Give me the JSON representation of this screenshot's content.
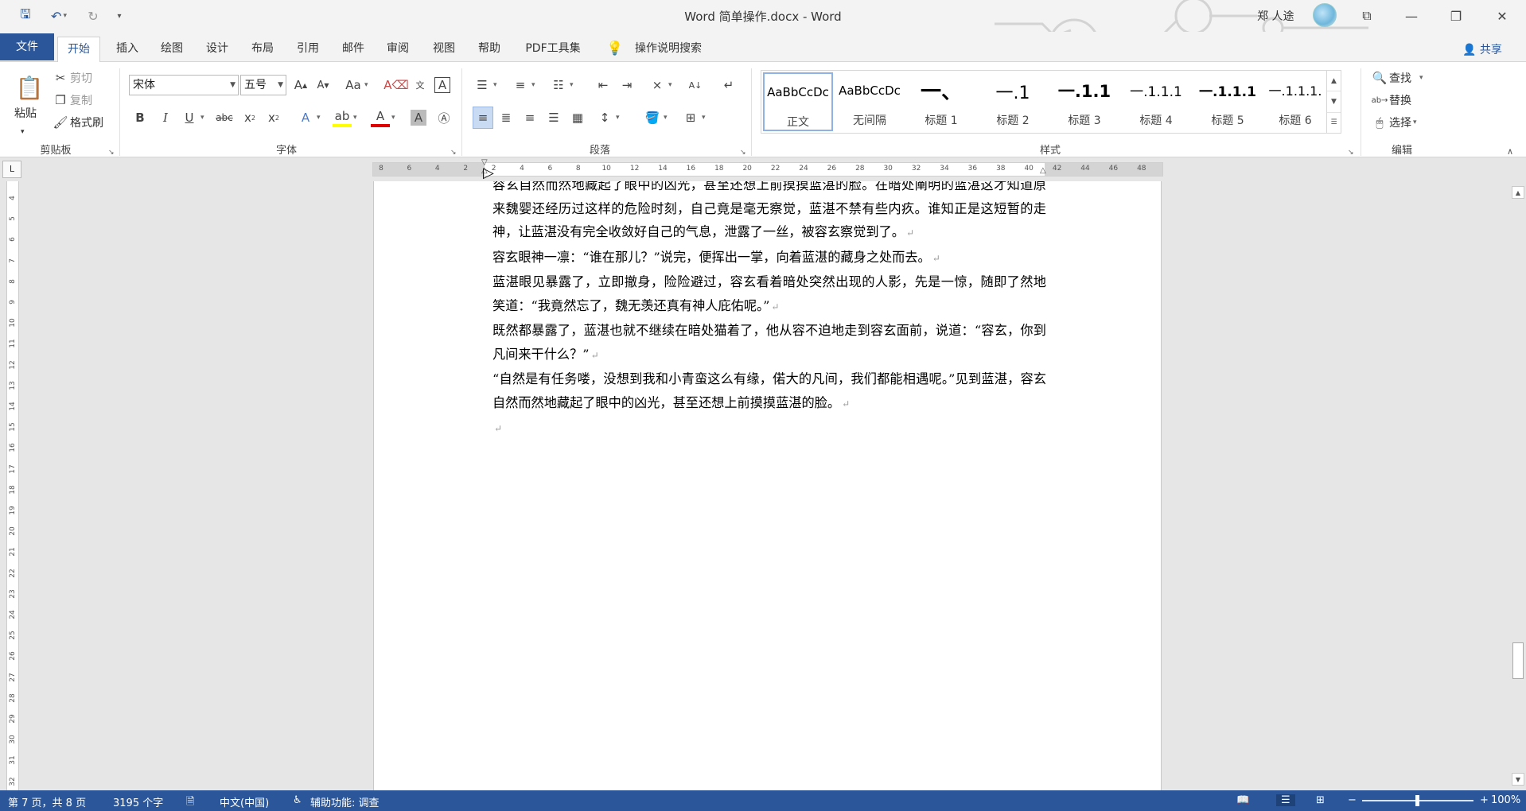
{
  "window": {
    "title": "Word 简单操作.docx  -  Word",
    "user_name": "郑 人途"
  },
  "tabs": [
    {
      "id": "tab-file",
      "label": "文件"
    },
    {
      "id": "tab-home",
      "label": "开始"
    },
    {
      "id": "tab-insert",
      "label": "插入"
    },
    {
      "id": "tab-draw",
      "label": "绘图"
    },
    {
      "id": "tab-design",
      "label": "设计"
    },
    {
      "id": "tab-layout",
      "label": "布局"
    },
    {
      "id": "tab-references",
      "label": "引用"
    },
    {
      "id": "tab-mailings",
      "label": "邮件"
    },
    {
      "id": "tab-review",
      "label": "审阅"
    },
    {
      "id": "tab-view",
      "label": "视图"
    },
    {
      "id": "tab-help",
      "label": "帮助"
    },
    {
      "id": "tab-pdf",
      "label": "PDF工具集"
    }
  ],
  "tell_me": "操作说明搜索",
  "share": "共享",
  "clipboard": {
    "paste": "粘贴",
    "cut": "剪切",
    "copy": "复制",
    "format_painter": "格式刷",
    "group": "剪贴板"
  },
  "font": {
    "name": "宋体",
    "size": "五号",
    "group": "字体"
  },
  "paragraph": {
    "group": "段落"
  },
  "styles": {
    "group": "样式",
    "items": [
      {
        "sample": "AaBbCcDc",
        "name": "正文"
      },
      {
        "sample": "AaBbCcDc",
        "name": "无间隔"
      },
      {
        "sample": "一、",
        "name": "标题 1"
      },
      {
        "sample": "一.1",
        "name": "标题 2"
      },
      {
        "sample": "一.1.1",
        "name": "标题 3"
      },
      {
        "sample": "一.1.1.1",
        "name": "标题 4"
      },
      {
        "sample": "一.1.1.1",
        "name": "标题 5"
      },
      {
        "sample": "一.1.1.1.",
        "name": "标题 6"
      }
    ]
  },
  "editing": {
    "find": "查找",
    "replace": "替换",
    "select": "选择",
    "group": "编辑"
  },
  "ruler": {
    "h_ticks": [
      "8",
      "6",
      "4",
      "2",
      "2",
      "4",
      "6",
      "8",
      "10",
      "12",
      "14",
      "16",
      "18",
      "20",
      "22",
      "24",
      "26",
      "28",
      "30",
      "32",
      "34",
      "36",
      "38",
      "40",
      "42",
      "44",
      "46",
      "48"
    ],
    "v_ticks": [
      "4",
      "5",
      "6",
      "7",
      "8",
      "9",
      "10",
      "11",
      "12",
      "13",
      "14",
      "15",
      "16",
      "17",
      "18",
      "19",
      "20",
      "21",
      "22",
      "23",
      "24",
      "25",
      "26",
      "27",
      "28",
      "29",
      "30",
      "31",
      "32"
    ]
  },
  "document": {
    "paragraphs": [
      "容玄自然而然地藏起了眼中的凶光，甚至还想上前摸摸蓝湛的脸。在暗处阐明的蓝湛这才知道原来魏婴还经历过这样的危险时刻，自己竟是毫无察觉，蓝湛不禁有些内疚。谁知正是这短暂的走神，让蓝湛没有完全收敛好自己的气息，泄露了一丝，被容玄察觉到了。",
      "容玄眼神一凛：“谁在那儿？”说完，便挥出一掌，向着蓝湛的藏身之处而去。",
      "蓝湛眼见暴露了，立即撤身，险险避过，容玄看着暗处突然出现的人影，先是一惊，随即了然地笑道：“我竟然忘了，魏无羡还真有神人庇佑呢。”",
      "既然都暴露了，蓝湛也就不继续在暗处猫着了，他从容不迫地走到容玄面前，说道：“容玄，你到凡间来干什么？”",
      "“自然是有任务喽，没想到我和小青蛮这么有缘，偌大的凡间，我们都能相遇呢。”见到蓝湛，容玄自然而然地藏起了眼中的凶光，甚至还想上前摸摸蓝湛的脸。",
      ""
    ],
    "para_mark": "↵"
  },
  "status": {
    "page": "第 7 页，共 8 页",
    "words": "3195 个字",
    "language": "中文(中国)",
    "accessibility": "辅助功能: 调查",
    "zoom": "100%",
    "zoom_level": 1.0
  },
  "colors": {
    "accent": "#2b579a",
    "ribbon_bg": "#ffffff",
    "canvas_bg": "#e6e6e6"
  }
}
